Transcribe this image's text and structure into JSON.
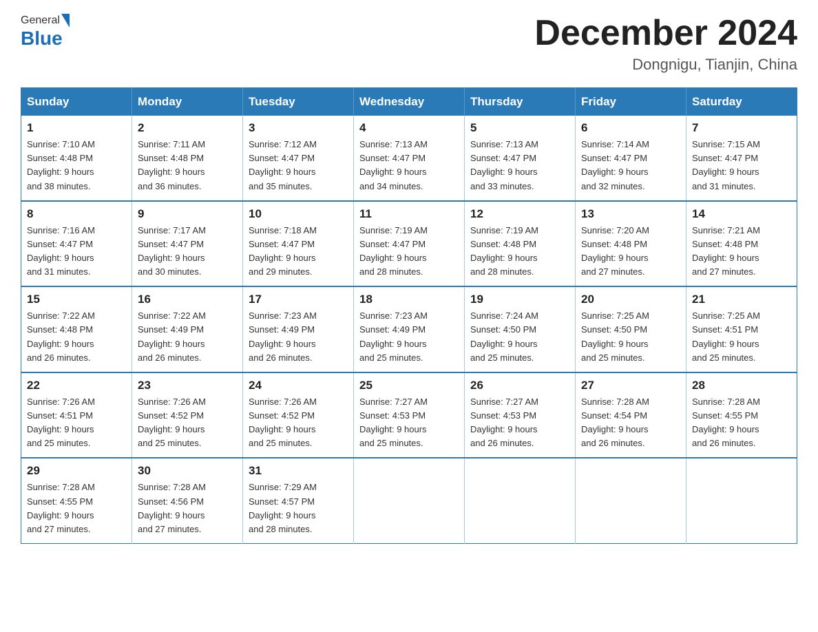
{
  "header": {
    "logo": {
      "text_general": "General",
      "text_blue": "Blue"
    },
    "title": "December 2024",
    "location": "Dongnigu, Tianjin, China"
  },
  "calendar": {
    "days_of_week": [
      "Sunday",
      "Monday",
      "Tuesday",
      "Wednesday",
      "Thursday",
      "Friday",
      "Saturday"
    ],
    "weeks": [
      [
        {
          "day": "1",
          "sunrise": "7:10 AM",
          "sunset": "4:48 PM",
          "daylight": "9 hours and 38 minutes."
        },
        {
          "day": "2",
          "sunrise": "7:11 AM",
          "sunset": "4:48 PM",
          "daylight": "9 hours and 36 minutes."
        },
        {
          "day": "3",
          "sunrise": "7:12 AM",
          "sunset": "4:47 PM",
          "daylight": "9 hours and 35 minutes."
        },
        {
          "day": "4",
          "sunrise": "7:13 AM",
          "sunset": "4:47 PM",
          "daylight": "9 hours and 34 minutes."
        },
        {
          "day": "5",
          "sunrise": "7:13 AM",
          "sunset": "4:47 PM",
          "daylight": "9 hours and 33 minutes."
        },
        {
          "day": "6",
          "sunrise": "7:14 AM",
          "sunset": "4:47 PM",
          "daylight": "9 hours and 32 minutes."
        },
        {
          "day": "7",
          "sunrise": "7:15 AM",
          "sunset": "4:47 PM",
          "daylight": "9 hours and 31 minutes."
        }
      ],
      [
        {
          "day": "8",
          "sunrise": "7:16 AM",
          "sunset": "4:47 PM",
          "daylight": "9 hours and 31 minutes."
        },
        {
          "day": "9",
          "sunrise": "7:17 AM",
          "sunset": "4:47 PM",
          "daylight": "9 hours and 30 minutes."
        },
        {
          "day": "10",
          "sunrise": "7:18 AM",
          "sunset": "4:47 PM",
          "daylight": "9 hours and 29 minutes."
        },
        {
          "day": "11",
          "sunrise": "7:19 AM",
          "sunset": "4:47 PM",
          "daylight": "9 hours and 28 minutes."
        },
        {
          "day": "12",
          "sunrise": "7:19 AM",
          "sunset": "4:48 PM",
          "daylight": "9 hours and 28 minutes."
        },
        {
          "day": "13",
          "sunrise": "7:20 AM",
          "sunset": "4:48 PM",
          "daylight": "9 hours and 27 minutes."
        },
        {
          "day": "14",
          "sunrise": "7:21 AM",
          "sunset": "4:48 PM",
          "daylight": "9 hours and 27 minutes."
        }
      ],
      [
        {
          "day": "15",
          "sunrise": "7:22 AM",
          "sunset": "4:48 PM",
          "daylight": "9 hours and 26 minutes."
        },
        {
          "day": "16",
          "sunrise": "7:22 AM",
          "sunset": "4:49 PM",
          "daylight": "9 hours and 26 minutes."
        },
        {
          "day": "17",
          "sunrise": "7:23 AM",
          "sunset": "4:49 PM",
          "daylight": "9 hours and 26 minutes."
        },
        {
          "day": "18",
          "sunrise": "7:23 AM",
          "sunset": "4:49 PM",
          "daylight": "9 hours and 25 minutes."
        },
        {
          "day": "19",
          "sunrise": "7:24 AM",
          "sunset": "4:50 PM",
          "daylight": "9 hours and 25 minutes."
        },
        {
          "day": "20",
          "sunrise": "7:25 AM",
          "sunset": "4:50 PM",
          "daylight": "9 hours and 25 minutes."
        },
        {
          "day": "21",
          "sunrise": "7:25 AM",
          "sunset": "4:51 PM",
          "daylight": "9 hours and 25 minutes."
        }
      ],
      [
        {
          "day": "22",
          "sunrise": "7:26 AM",
          "sunset": "4:51 PM",
          "daylight": "9 hours and 25 minutes."
        },
        {
          "day": "23",
          "sunrise": "7:26 AM",
          "sunset": "4:52 PM",
          "daylight": "9 hours and 25 minutes."
        },
        {
          "day": "24",
          "sunrise": "7:26 AM",
          "sunset": "4:52 PM",
          "daylight": "9 hours and 25 minutes."
        },
        {
          "day": "25",
          "sunrise": "7:27 AM",
          "sunset": "4:53 PM",
          "daylight": "9 hours and 25 minutes."
        },
        {
          "day": "26",
          "sunrise": "7:27 AM",
          "sunset": "4:53 PM",
          "daylight": "9 hours and 26 minutes."
        },
        {
          "day": "27",
          "sunrise": "7:28 AM",
          "sunset": "4:54 PM",
          "daylight": "9 hours and 26 minutes."
        },
        {
          "day": "28",
          "sunrise": "7:28 AM",
          "sunset": "4:55 PM",
          "daylight": "9 hours and 26 minutes."
        }
      ],
      [
        {
          "day": "29",
          "sunrise": "7:28 AM",
          "sunset": "4:55 PM",
          "daylight": "9 hours and 27 minutes."
        },
        {
          "day": "30",
          "sunrise": "7:28 AM",
          "sunset": "4:56 PM",
          "daylight": "9 hours and 27 minutes."
        },
        {
          "day": "31",
          "sunrise": "7:29 AM",
          "sunset": "4:57 PM",
          "daylight": "9 hours and 28 minutes."
        },
        null,
        null,
        null,
        null
      ]
    ]
  }
}
